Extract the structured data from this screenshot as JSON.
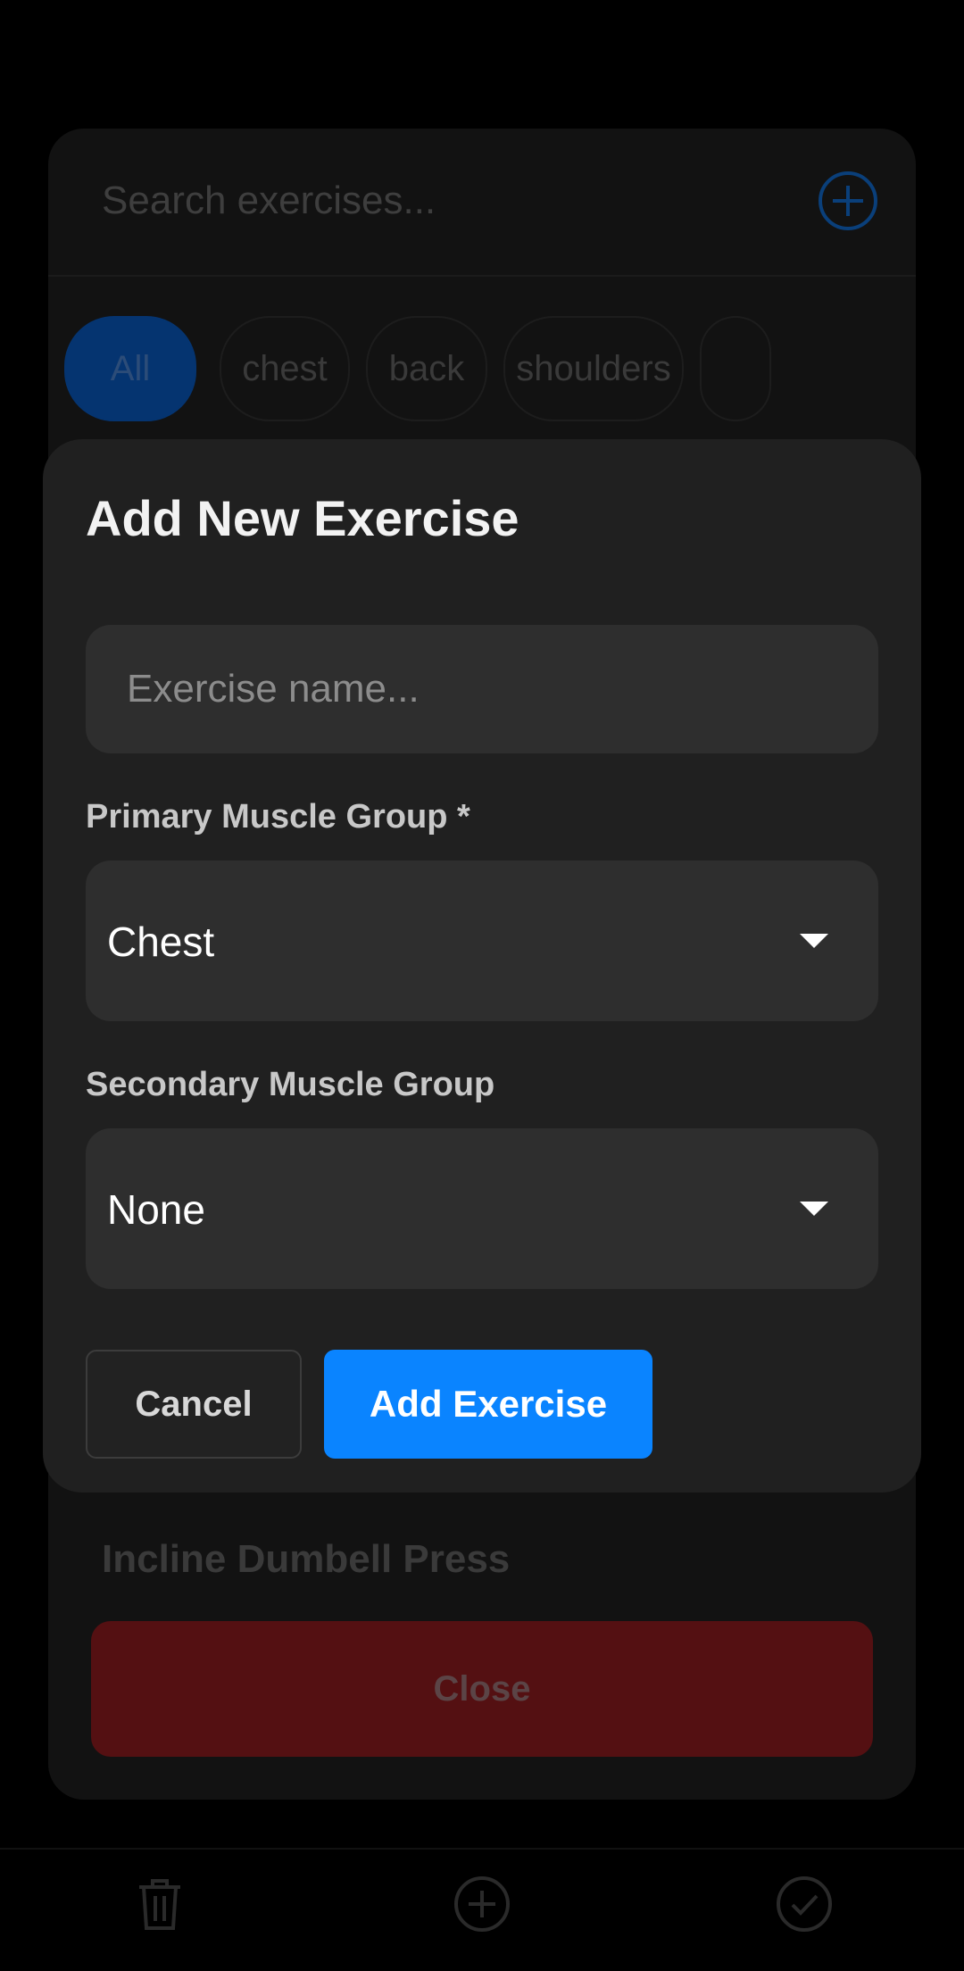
{
  "background": {
    "search_placeholder": "Search exercises...",
    "chips": [
      "All",
      "chest",
      "back",
      "shoulders"
    ],
    "exercise_title": "Incline Dumbell Press",
    "close_label": "Close",
    "icons": [
      "add-circle-icon",
      "trash-icon",
      "plus-circle-icon",
      "check-circle-icon"
    ]
  },
  "modal": {
    "title": "Add New Exercise",
    "name_placeholder": "Exercise name...",
    "name_value": "",
    "primary_label": "Primary Muscle Group *",
    "primary_value": "Chest",
    "secondary_label": "Secondary Muscle Group",
    "secondary_value": "None",
    "cancel_label": "Cancel",
    "add_label": "Add Exercise"
  },
  "colors": {
    "accent": "#0a84ff",
    "danger": "#541012",
    "surface": "#202020",
    "field": "#2e2e2e"
  }
}
